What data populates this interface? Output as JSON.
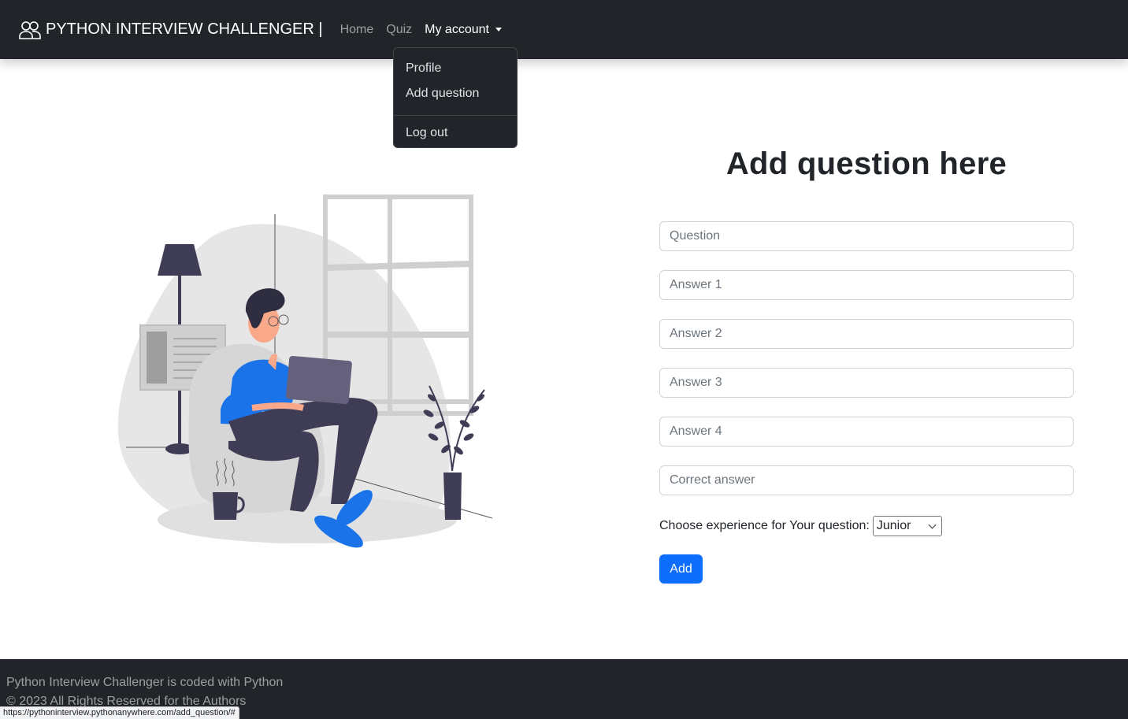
{
  "navbar": {
    "brand": "PYTHON INTERVIEW CHALLENGER |",
    "brand_icon": "people-icon",
    "links": {
      "home": "Home",
      "quiz": "Quiz",
      "account": "My account"
    }
  },
  "dropdown": {
    "profile": "Profile",
    "add_question": "Add question",
    "logout": "Log out"
  },
  "form": {
    "title": "Add question here",
    "question_placeholder": "Question",
    "answer1_placeholder": "Answer 1",
    "answer2_placeholder": "Answer 2",
    "answer3_placeholder": "Answer 3",
    "answer4_placeholder": "Answer 4",
    "correct_placeholder": "Correct answer",
    "experience_label": "Choose experience for Your question:",
    "experience_selected": "Junior",
    "add_label": "Add"
  },
  "footer": {
    "line1": "Python Interview Challenger is coded with Python",
    "line2": "© 2023 All Rights Reserved for the Authors"
  },
  "status_url": "https://pythoninterview.pythonanywhere.com/add_question/#",
  "colors": {
    "navbar_bg": "#212529",
    "primary": "#0d6efd",
    "illustration_blue": "#1a73e8",
    "illustration_dark": "#3f3d56"
  }
}
